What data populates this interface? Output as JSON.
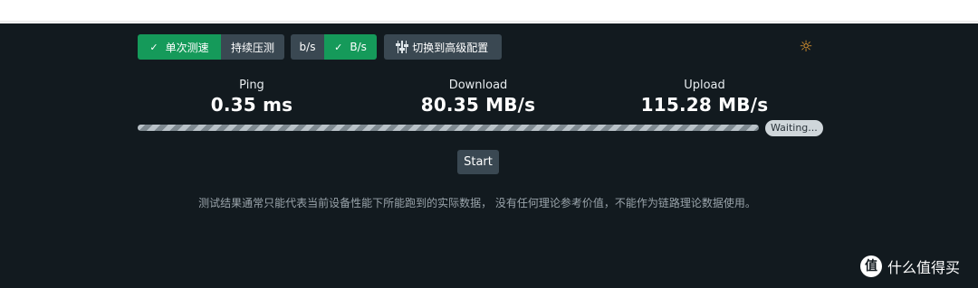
{
  "toolbar": {
    "single_test_label": "单次测速",
    "continuous_test_label": "持续压测",
    "bits_label": "b/s",
    "bytes_label": "B/s",
    "advanced_label": "切换到高级配置",
    "selected_mode": "单次测速",
    "selected_unit": "B/s"
  },
  "theme_icon": "sun-icon",
  "metrics": {
    "ping": {
      "label": "Ping",
      "value": "0.35 ms"
    },
    "download": {
      "label": "Download",
      "value": "80.35 MB/s"
    },
    "upload": {
      "label": "Upload",
      "value": "115.28 MB/s"
    }
  },
  "progress": {
    "fraction": 1.0,
    "status": "Waiting..."
  },
  "start_label": "Start",
  "disclaimer": "测试结果通常只能代表当前设备性能下所能跑到的实际数据， 没有任何理论参考价值，不能作为链路理论数据使用。",
  "watermark": {
    "logo_text": "值",
    "text": "什么值得买"
  },
  "colors": {
    "background": "#121a1f",
    "accent_green": "#159a5a",
    "button_dark": "#3a4852",
    "sun_orange": "#f0a030"
  }
}
